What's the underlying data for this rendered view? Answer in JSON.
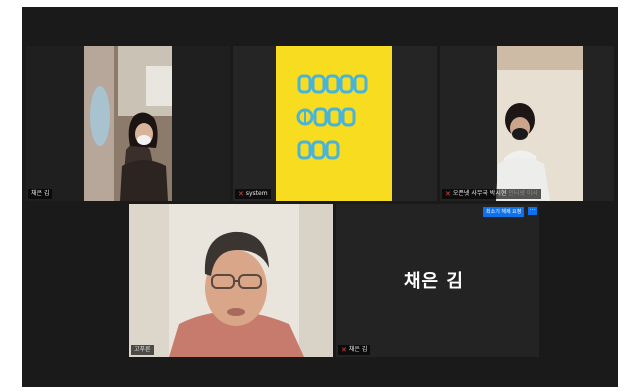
{
  "tiles": {
    "top_left": {
      "name": "채은 김",
      "active": true
    },
    "top_middle": {
      "name": "system",
      "logo_words": [
        "PEACE",
        "OPEN",
        "DDD"
      ],
      "logo_bg": "#f7dc1f",
      "logo_fg": "#4ab3d8"
    },
    "top_right": {
      "name": "오픈넷 사무국 박시현",
      "extra": "인터넷 이사"
    },
    "bottom_left": {
      "name": "고푸른"
    },
    "bottom_right": {
      "name": "채은 김",
      "display_name": "채은 김",
      "action_label": "최소기 해제 요청",
      "more_label": "···"
    }
  },
  "colors": {
    "accent": "#0e71eb",
    "active_border": "#d8e86a",
    "muted_mic": "#e0464a"
  }
}
